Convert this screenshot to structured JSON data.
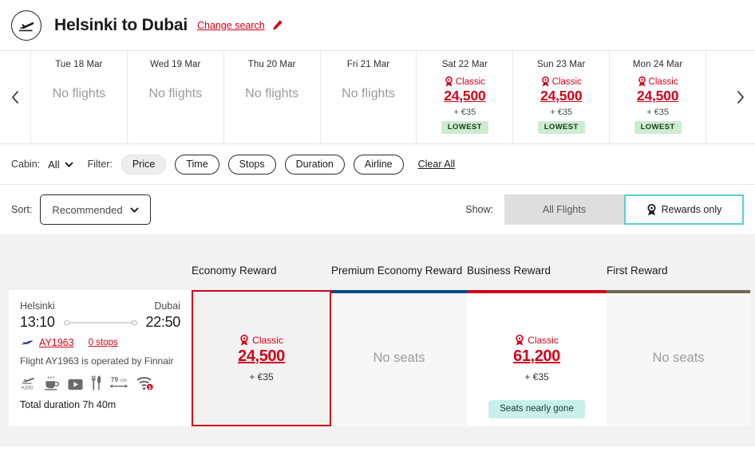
{
  "header": {
    "route_title": "Helsinki to Dubai",
    "change_search_label": "Change search",
    "plane_icon": "plane-takeoff-circle-icon",
    "pencil_icon": "pencil-edit-icon"
  },
  "carousel": {
    "prev_icon": "chevron-left-icon",
    "next_icon": "chevron-right-icon",
    "no_flights_label": "No flights",
    "days": [
      {
        "date": "Tue 18 Mar",
        "status": "none"
      },
      {
        "date": "Wed 19 Mar",
        "status": "none"
      },
      {
        "date": "Thu 20 Mar",
        "status": "none"
      },
      {
        "date": "Fri 21 Mar",
        "status": "none"
      },
      {
        "date": "Sat 22 Mar",
        "status": "price",
        "cabin": "Classic",
        "price": "24,500",
        "fee": "+ €35",
        "badge": "LOWEST"
      },
      {
        "date": "Sun 23 Mar",
        "status": "price",
        "cabin": "Classic",
        "price": "24,500",
        "fee": "+ €35",
        "badge": "LOWEST"
      },
      {
        "date": "Mon 24 Mar",
        "status": "price",
        "cabin": "Classic",
        "price": "24,500",
        "fee": "+ €35",
        "badge": "LOWEST"
      }
    ]
  },
  "filterbar": {
    "cabin_label": "Cabin:",
    "cabin_value": "All",
    "filter_label": "Filter:",
    "chips": [
      {
        "label": "Price",
        "active": true
      },
      {
        "label": "Time",
        "active": false
      },
      {
        "label": "Stops",
        "active": false
      },
      {
        "label": "Duration",
        "active": false
      },
      {
        "label": "Airline",
        "active": false
      }
    ],
    "clear_all_label": "Clear All"
  },
  "sortrow": {
    "sort_label": "Sort:",
    "sort_value": "Recommended",
    "show_label": "Show:",
    "toggle_all_label": "All Flights",
    "toggle_rewards_label": "Rewards only",
    "toggle_selected": "rewards"
  },
  "results": {
    "columns": [
      {
        "key": "economy",
        "label": "Economy Reward",
        "accent": "#d0021b"
      },
      {
        "key": "premium",
        "label": "Premium Economy Reward",
        "accent": "#004b87"
      },
      {
        "key": "business",
        "label": "Business Reward",
        "accent": "#d0021b"
      },
      {
        "key": "first",
        "label": "First Reward",
        "accent": "#6e6a4f"
      }
    ],
    "flight": {
      "origin_city": "Helsinki",
      "dest_city": "Dubai",
      "depart_time": "13:10",
      "arrive_time": "22:50",
      "flight_number": "AY1963",
      "stops": "0 stops",
      "operated_by": "Flight AY1963 is operated by Finnair",
      "total_duration": "Total duration 7h 40m",
      "amenities": [
        {
          "icon": "aircraft-a330-icon",
          "label": "A330"
        },
        {
          "icon": "coffee-cup-icon",
          "label": ""
        },
        {
          "icon": "video-screen-icon",
          "label": ""
        },
        {
          "icon": "meal-cutlery-icon",
          "label": ""
        },
        {
          "icon": "seat-pitch-icon",
          "label": "79cm"
        },
        {
          "icon": "wifi-paid-icon",
          "label": ""
        }
      ]
    },
    "fares": [
      {
        "column": "economy",
        "state": "available",
        "cabin": "Classic",
        "price": "24,500",
        "fee": "+ €35",
        "selected": true,
        "badge": ""
      },
      {
        "column": "premium",
        "state": "unavailable",
        "no_seats_label": "No seats"
      },
      {
        "column": "business",
        "state": "available",
        "cabin": "Classic",
        "price": "61,200",
        "fee": "+ €35",
        "selected": false,
        "badge": "Seats nearly gone"
      },
      {
        "column": "first",
        "state": "unavailable",
        "no_seats_label": "No seats"
      }
    ]
  }
}
